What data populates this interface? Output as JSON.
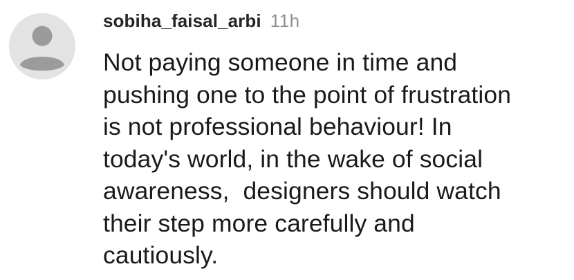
{
  "comment": {
    "avatar_icon": "default-user-avatar-icon",
    "username": "sobiha_faisal_arbi",
    "time_ago": "11h",
    "text_lines": [
      "Not paying someone in time and",
      "pushing one to the point of frustration",
      "is not professional behaviour! In",
      "today's world, in the wake of social",
      "awareness,  designers should watch",
      "their step more carefully and",
      "cautiously."
    ]
  }
}
